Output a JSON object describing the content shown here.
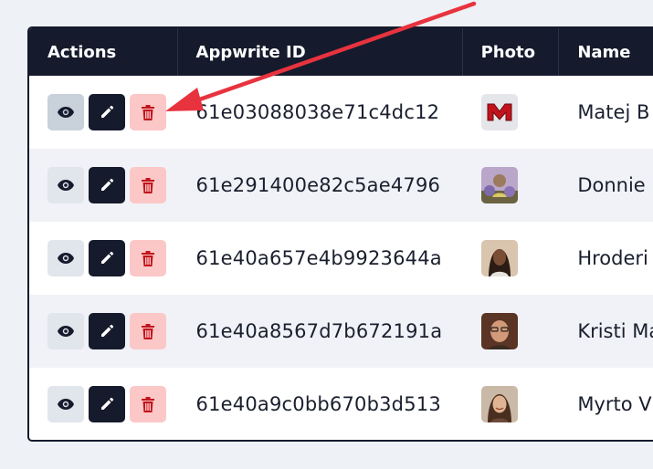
{
  "table": {
    "headers": {
      "actions": "Actions",
      "id": "Appwrite ID",
      "photo": "Photo",
      "name": "Name"
    },
    "rows": [
      {
        "id": "61e03088038e71c4dc12",
        "name": "Matej B",
        "avatar": "letter-m-logo",
        "accent": "#c2131d"
      },
      {
        "id": "61e291400e82c5ae4796",
        "name": "Donnie",
        "avatar": "photo-group",
        "accent": "#7c6a9c"
      },
      {
        "id": "61e40a657e4b9923644a",
        "name": "Hroderi",
        "avatar": "photo-woman",
        "accent": "#6b4a36"
      },
      {
        "id": "61e40a8567d7b672191a",
        "name": "Kristi Ma",
        "avatar": "photo-man-glasses",
        "accent": "#7a4d35"
      },
      {
        "id": "61e40a9c0bb670b3d513",
        "name": "Myrto V",
        "avatar": "photo-woman-smile",
        "accent": "#5e3b28"
      }
    ]
  },
  "icons": {
    "view": "eye-icon",
    "edit": "pencil-icon",
    "delete": "trash-icon"
  },
  "annotation": {
    "arrow_color": "#e8333f"
  }
}
